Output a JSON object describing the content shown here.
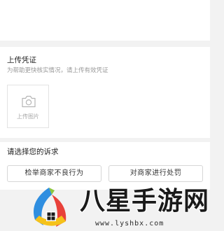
{
  "upload": {
    "title": "上传凭证",
    "hint": "为帮助更快核实情况，请上传有效凭证",
    "button_label": "上传图片"
  },
  "complaint": {
    "title": "请选择您的诉求",
    "options": [
      {
        "label": "检举商家不良行为"
      },
      {
        "label": "对商家进行处罚"
      }
    ]
  },
  "watermark": {
    "title": "八星手游网",
    "url": "www.lyshbx.com"
  },
  "colors": {
    "background": "#f2f2f2",
    "card": "#ffffff",
    "text_primary": "#222222",
    "text_hint": "#9a9a9a"
  },
  "icons": {
    "upload": "camera-icon",
    "watermark_logo": "house-logo-icon"
  }
}
